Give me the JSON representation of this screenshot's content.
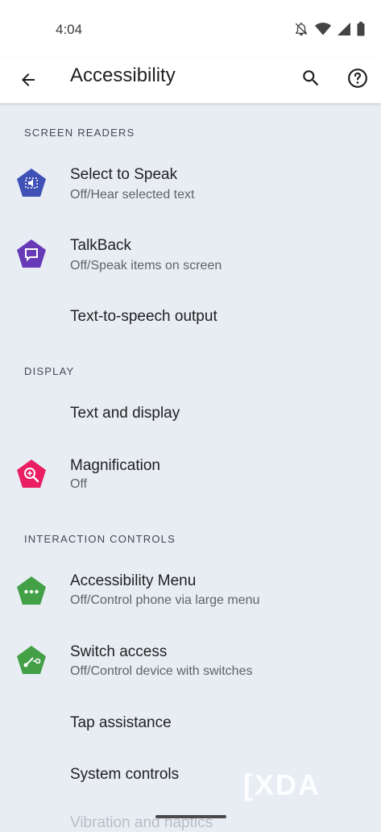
{
  "status_bar": {
    "time": "4:04"
  },
  "app_bar": {
    "title": "Accessibility"
  },
  "sections": {
    "screen_readers": "SCREEN READERS",
    "display": "DISPLAY",
    "interaction_controls": "INTERACTION CONTROLS"
  },
  "items": {
    "select_to_speak": {
      "label": "Select to Speak",
      "sub": "Off/Hear selected text",
      "color": "#3f51b5"
    },
    "talkback": {
      "label": "TalkBack",
      "sub": "Off/Speak items on screen",
      "color": "#673ab7"
    },
    "tts": {
      "label": "Text-to-speech output"
    },
    "text_display": {
      "label": "Text and display"
    },
    "magnification": {
      "label": "Magnification",
      "sub": "Off",
      "color": "#e91e63"
    },
    "accessibility_menu": {
      "label": "Accessibility Menu",
      "sub": "Off/Control phone via large menu",
      "color": "#43a047"
    },
    "switch_access": {
      "label": "Switch access",
      "sub": "Off/Control device with switches",
      "color": "#43a047"
    },
    "tap_assistance": {
      "label": "Tap assistance"
    },
    "system_controls": {
      "label": "System controls"
    },
    "vibration": {
      "label": "Vibration and haptics"
    }
  },
  "watermark": "XDA"
}
